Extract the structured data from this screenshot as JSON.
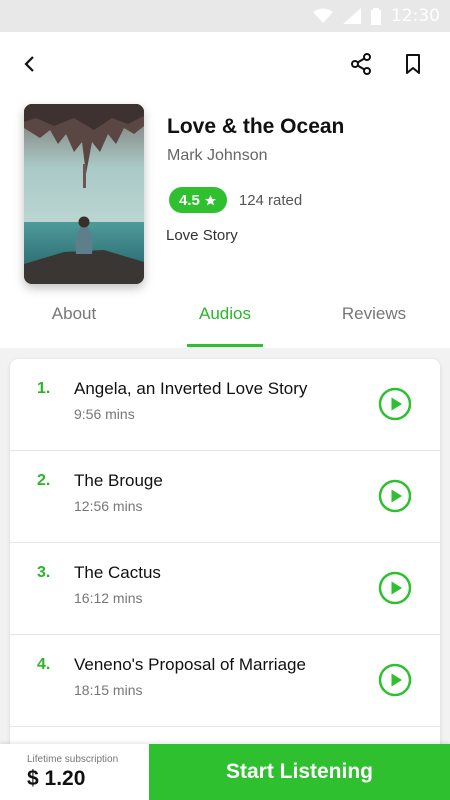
{
  "status_bar": {
    "time": "12:30"
  },
  "book": {
    "title": "Love & the Ocean",
    "author": "Mark Johnson",
    "rating": "4.5",
    "rated_count": "124 rated",
    "genre": "Love Story"
  },
  "tabs": [
    {
      "label": "About",
      "active": false
    },
    {
      "label": "Audios",
      "active": true
    },
    {
      "label": "Reviews",
      "active": false
    }
  ],
  "tracks": [
    {
      "number": "1.",
      "title": "Angela, an Inverted Love Story",
      "duration": "9:56 mins"
    },
    {
      "number": "2.",
      "title": "The Brouge",
      "duration": "12:56 mins"
    },
    {
      "number": "3.",
      "title": "The Cactus",
      "duration": "16:12 mins"
    },
    {
      "number": "4.",
      "title": "Veneno's Proposal of Marriage",
      "duration": "18:15 mins"
    }
  ],
  "purchase": {
    "subscription_label": "Lifetime subscription",
    "price": "$ 1.20",
    "cta_label": "Start Listening"
  },
  "icons": {
    "back": "chevron-left-icon",
    "share": "share-icon",
    "bookmark": "bookmark-icon",
    "star": "star-icon",
    "play": "play-circle-icon"
  },
  "colors": {
    "accent": "#2ec02e",
    "status_bar": "#e8e8e8"
  }
}
